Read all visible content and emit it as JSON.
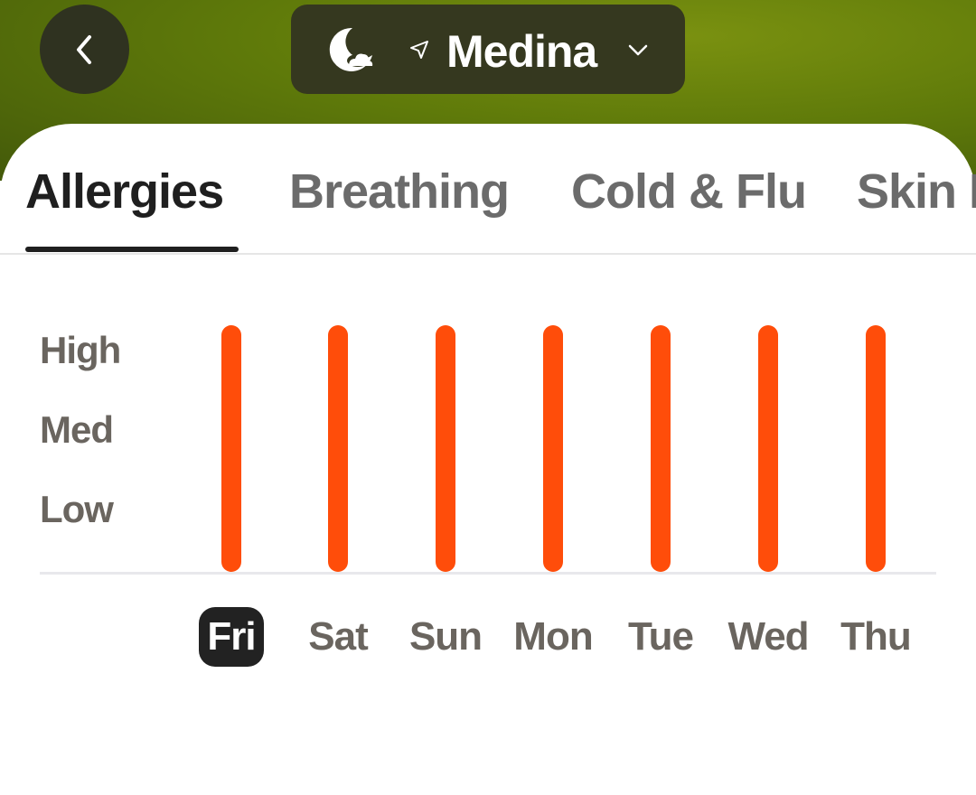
{
  "header": {
    "location": "Medina",
    "back_icon": "chevron-left-icon",
    "weather_icon": "moon-cloud-icon",
    "location_icon": "navigation-arrow-icon",
    "dropdown_icon": "chevron-down-icon"
  },
  "tabs": [
    {
      "label": "Allergies",
      "active": true
    },
    {
      "label": "Breathing",
      "active": false
    },
    {
      "label": "Cold & Flu",
      "active": false
    },
    {
      "label": "Skin Health",
      "active": false
    }
  ],
  "chart_data": {
    "type": "bar",
    "y_levels": [
      "Low",
      "Med",
      "High"
    ],
    "categories": [
      "Fri",
      "Sat",
      "Sun",
      "Mon",
      "Tue",
      "Wed",
      "Thu"
    ],
    "values": [
      3,
      3,
      3,
      3,
      3,
      3,
      3
    ],
    "ylim": [
      0,
      3
    ],
    "selected_category": "Fri",
    "bar_color": "#ff4d0a"
  }
}
